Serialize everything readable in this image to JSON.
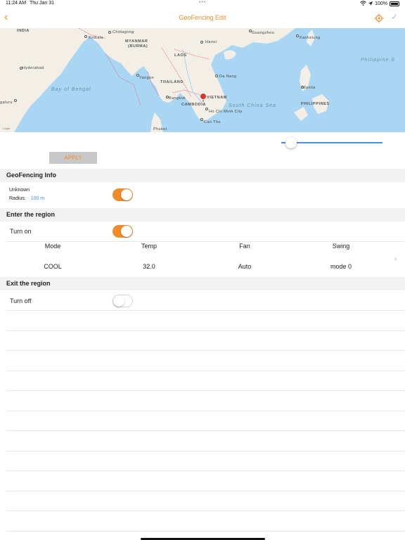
{
  "status_bar": {
    "time": "11:24 AM",
    "date": "Thu Jan 31",
    "dots": "•••",
    "battery": "100%"
  },
  "nav": {
    "title": "GeoFencing Edit",
    "back_glyph": "‹",
    "check_glyph": "✓"
  },
  "map": {
    "labels": {
      "india": "INDIA",
      "chittagong": "Chittagong",
      "kolkata": "Kolkata",
      "myanmar": "MYANMAR",
      "burma": "(BURMA)",
      "hanoi": "Hanoi",
      "guangzhou": "Guangzhou",
      "kaohsiung": "Kaohsiung",
      "philippine_sea": "Philippine S",
      "laos": "LAOS",
      "hyderabad": "Hyderabad",
      "yangon": "Yangon",
      "da_nang": "Da Nang",
      "thailand": "THAILAND",
      "bay_of_bengal": "Bay of Bengal",
      "manila": "Manila",
      "bangkok": "Bangkok",
      "vietnam": "VIETNAM",
      "cambodia": "CAMBODIA",
      "south_china_sea": "South China Sea",
      "philippines": "PHILIPPINES",
      "galuru": "galuru",
      "ho_chi_minh": "Ho Chi Minh City",
      "can_tho": "Can Tho",
      "phuket": "Phuket",
      "legal": "Legal"
    },
    "colors": {
      "water": "#a9d6f3",
      "land": "#f3efe6",
      "border": "#e07a9a"
    }
  },
  "radius_slider": {
    "value_fraction": 0.05
  },
  "apply_label": "APPLY",
  "geofencing_info": {
    "header": "GeoFencing Info",
    "name": "Unknown",
    "radius_label": "Radius:",
    "radius_value": "100 m",
    "enabled": true
  },
  "enter_region": {
    "header": "Enter the region",
    "toggle_label": "Turn on",
    "enabled": true,
    "columns": [
      "Mode",
      "Temp",
      "Fan",
      "Swing"
    ],
    "values": [
      "COOL",
      "32.0",
      "Auto",
      "mode 0"
    ],
    "chevron": "›"
  },
  "exit_region": {
    "header": "Exit the region",
    "toggle_label": "Turn off",
    "enabled": false
  },
  "colors": {
    "accent": "#f28c28",
    "link": "#4a90e2",
    "section_bg": "#f2f2f2"
  }
}
